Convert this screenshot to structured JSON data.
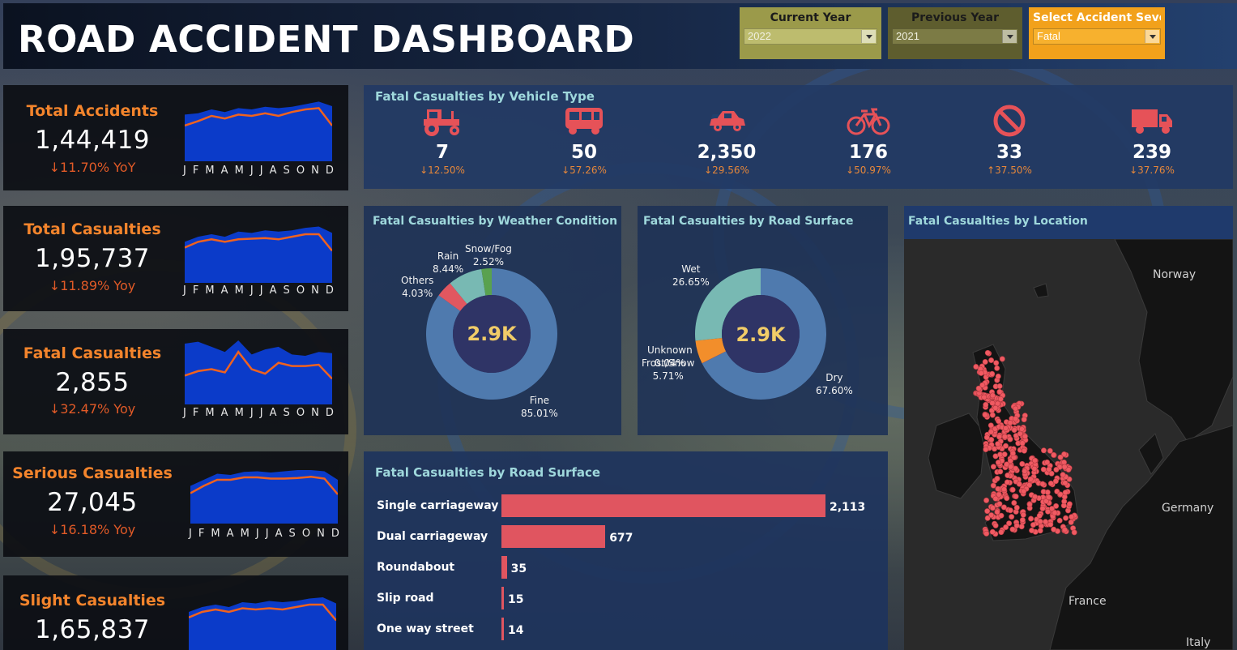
{
  "header": {
    "title": "ROAD ACCIDENT DASHBOARD"
  },
  "filters": [
    {
      "label": "Current Year",
      "value": "2022",
      "color": "#9b9a4a"
    },
    {
      "label": "Previous Year",
      "value": "2021",
      "color": "#5e5d2e"
    },
    {
      "label": "Select Accident Severi..",
      "value": "Fatal",
      "color": "#f2a11b"
    }
  ],
  "months": [
    "J",
    "F",
    "M",
    "A",
    "M",
    "J",
    "J",
    "A",
    "S",
    "O",
    "N",
    "D"
  ],
  "kpis": [
    {
      "label": "Total Accidents",
      "value": "1,44,419",
      "yoy": "↓11.70% YoY",
      "current": [
        0.55,
        0.62,
        0.7,
        0.66,
        0.72,
        0.7,
        0.74,
        0.7,
        0.76,
        0.8,
        0.82,
        0.55
      ],
      "previous": [
        0.55,
        0.63,
        0.74,
        0.66,
        0.72,
        0.74,
        0.74,
        0.7,
        0.76,
        0.8,
        0.82,
        0.55
      ],
      "area_top": [
        0.72,
        0.74,
        0.8,
        0.76,
        0.82,
        0.8,
        0.84,
        0.82,
        0.84,
        0.88,
        0.92,
        0.85
      ]
    },
    {
      "label": "Total Casualties",
      "value": "1,95,737",
      "yoy": "↓11.89% Yoy",
      "current": [
        0.55,
        0.64,
        0.68,
        0.64,
        0.68,
        0.69,
        0.7,
        0.68,
        0.72,
        0.76,
        0.76,
        0.5
      ],
      "previous": [
        0.55,
        0.64,
        0.68,
        0.64,
        0.68,
        0.69,
        0.7,
        0.68,
        0.72,
        0.76,
        0.76,
        0.5
      ],
      "area_top": [
        0.64,
        0.72,
        0.76,
        0.72,
        0.8,
        0.78,
        0.82,
        0.8,
        0.82,
        0.86,
        0.88,
        0.78
      ]
    },
    {
      "label": "Fatal Casualties",
      "value": "2,855",
      "yoy": "↓32.47% Yoy",
      "current": [
        0.45,
        0.52,
        0.55,
        0.5,
        0.82,
        0.55,
        0.48,
        0.65,
        0.6,
        0.6,
        0.62,
        0.4
      ],
      "previous": [
        0.45,
        0.52,
        0.55,
        0.5,
        0.82,
        0.55,
        0.48,
        0.65,
        0.6,
        0.6,
        0.62,
        0.4
      ],
      "area_top": [
        0.95,
        0.98,
        0.9,
        0.82,
        1.0,
        0.78,
        0.86,
        0.9,
        0.78,
        0.76,
        0.82,
        0.8
      ]
    },
    {
      "label": "Serious Casualties",
      "value": "27,045",
      "yoy": "↓16.18% Yoy",
      "current": [
        0.5,
        0.62,
        0.72,
        0.72,
        0.76,
        0.76,
        0.74,
        0.74,
        0.75,
        0.77,
        0.74,
        0.48
      ],
      "previous": [
        0.5,
        0.62,
        0.72,
        0.72,
        0.76,
        0.76,
        0.74,
        0.74,
        0.75,
        0.77,
        0.74,
        0.48
      ],
      "area_top": [
        0.62,
        0.72,
        0.82,
        0.8,
        0.85,
        0.86,
        0.84,
        0.86,
        0.88,
        0.88,
        0.86,
        0.72
      ]
    },
    {
      "label": "Slight Casualties",
      "value": "1,65,837",
      "yoy": "",
      "current": [
        0.55,
        0.64,
        0.68,
        0.64,
        0.7,
        0.68,
        0.7,
        0.68,
        0.72,
        0.76,
        0.76,
        0.5
      ],
      "previous": [
        0.55,
        0.64,
        0.68,
        0.64,
        0.7,
        0.68,
        0.7,
        0.68,
        0.72,
        0.76,
        0.76,
        0.5
      ],
      "area_top": [
        0.64,
        0.72,
        0.76,
        0.72,
        0.8,
        0.78,
        0.82,
        0.8,
        0.82,
        0.86,
        0.88,
        0.78
      ]
    }
  ],
  "vehicle_panel": {
    "title": "Fatal Casualties by Vehicle Type",
    "items": [
      {
        "icon": "tractor-icon",
        "value": "7",
        "pct": "↓12.50%"
      },
      {
        "icon": "bus-icon",
        "value": "50",
        "pct": "↓57.26%"
      },
      {
        "icon": "car-icon",
        "value": "2,350",
        "pct": "↓29.56%"
      },
      {
        "icon": "bicycle-icon",
        "value": "176",
        "pct": "↓50.97%"
      },
      {
        "icon": "no-entry-icon",
        "value": "33",
        "pct": "↑37.50%"
      },
      {
        "icon": "truck-icon",
        "value": "239",
        "pct": "↓37.76%"
      }
    ],
    "icon_color": "#e65258"
  },
  "chart_data": [
    {
      "type": "pie",
      "title": "Fatal Casualties by Weather Condition",
      "center": "2.9K",
      "slices": [
        {
          "label": "Fine",
          "pct": "85.01%",
          "value": 85.01,
          "color": "#4f7aae"
        },
        {
          "label": "Others",
          "pct": "4.03%",
          "value": 4.03,
          "color": "#e15760"
        },
        {
          "label": "Rain",
          "pct": "8.44%",
          "value": 8.44,
          "color": "#78b9b3"
        },
        {
          "label": "Snow/Fog",
          "pct": "2.52%",
          "value": 2.52,
          "color": "#59a14f"
        }
      ]
    },
    {
      "type": "pie",
      "title": "Fatal Casualties by Road Surface",
      "center": "2.9K",
      "slices": [
        {
          "label": "Dry",
          "pct": "67.60%",
          "value": 67.6,
          "color": "#4f7aae"
        },
        {
          "label": "Unknown",
          "pct": "0.04%",
          "value": 0.04,
          "color": "#e15760"
        },
        {
          "label": "Frost/Snow",
          "pct": "5.71%",
          "value": 5.71,
          "color": "#f28e2b"
        },
        {
          "label": "Wet",
          "pct": "26.65%",
          "value": 26.65,
          "color": "#78b9b3"
        }
      ]
    },
    {
      "type": "bar",
      "title": "Fatal Casualties by Road Surface",
      "categories": [
        "Single carriageway",
        "Dual carriageway",
        "Roundabout",
        "Slip road",
        "One way street"
      ],
      "values": [
        2113,
        677,
        35,
        15,
        14
      ],
      "labels": [
        "2,113",
        "677",
        "35",
        "15",
        "14"
      ],
      "color": "#e05560"
    }
  ],
  "map": {
    "title": "Fatal Casualties by Location",
    "labels": [
      "Norway",
      "Germany",
      "France",
      "Italy"
    ],
    "point_color": "#f05a62"
  }
}
